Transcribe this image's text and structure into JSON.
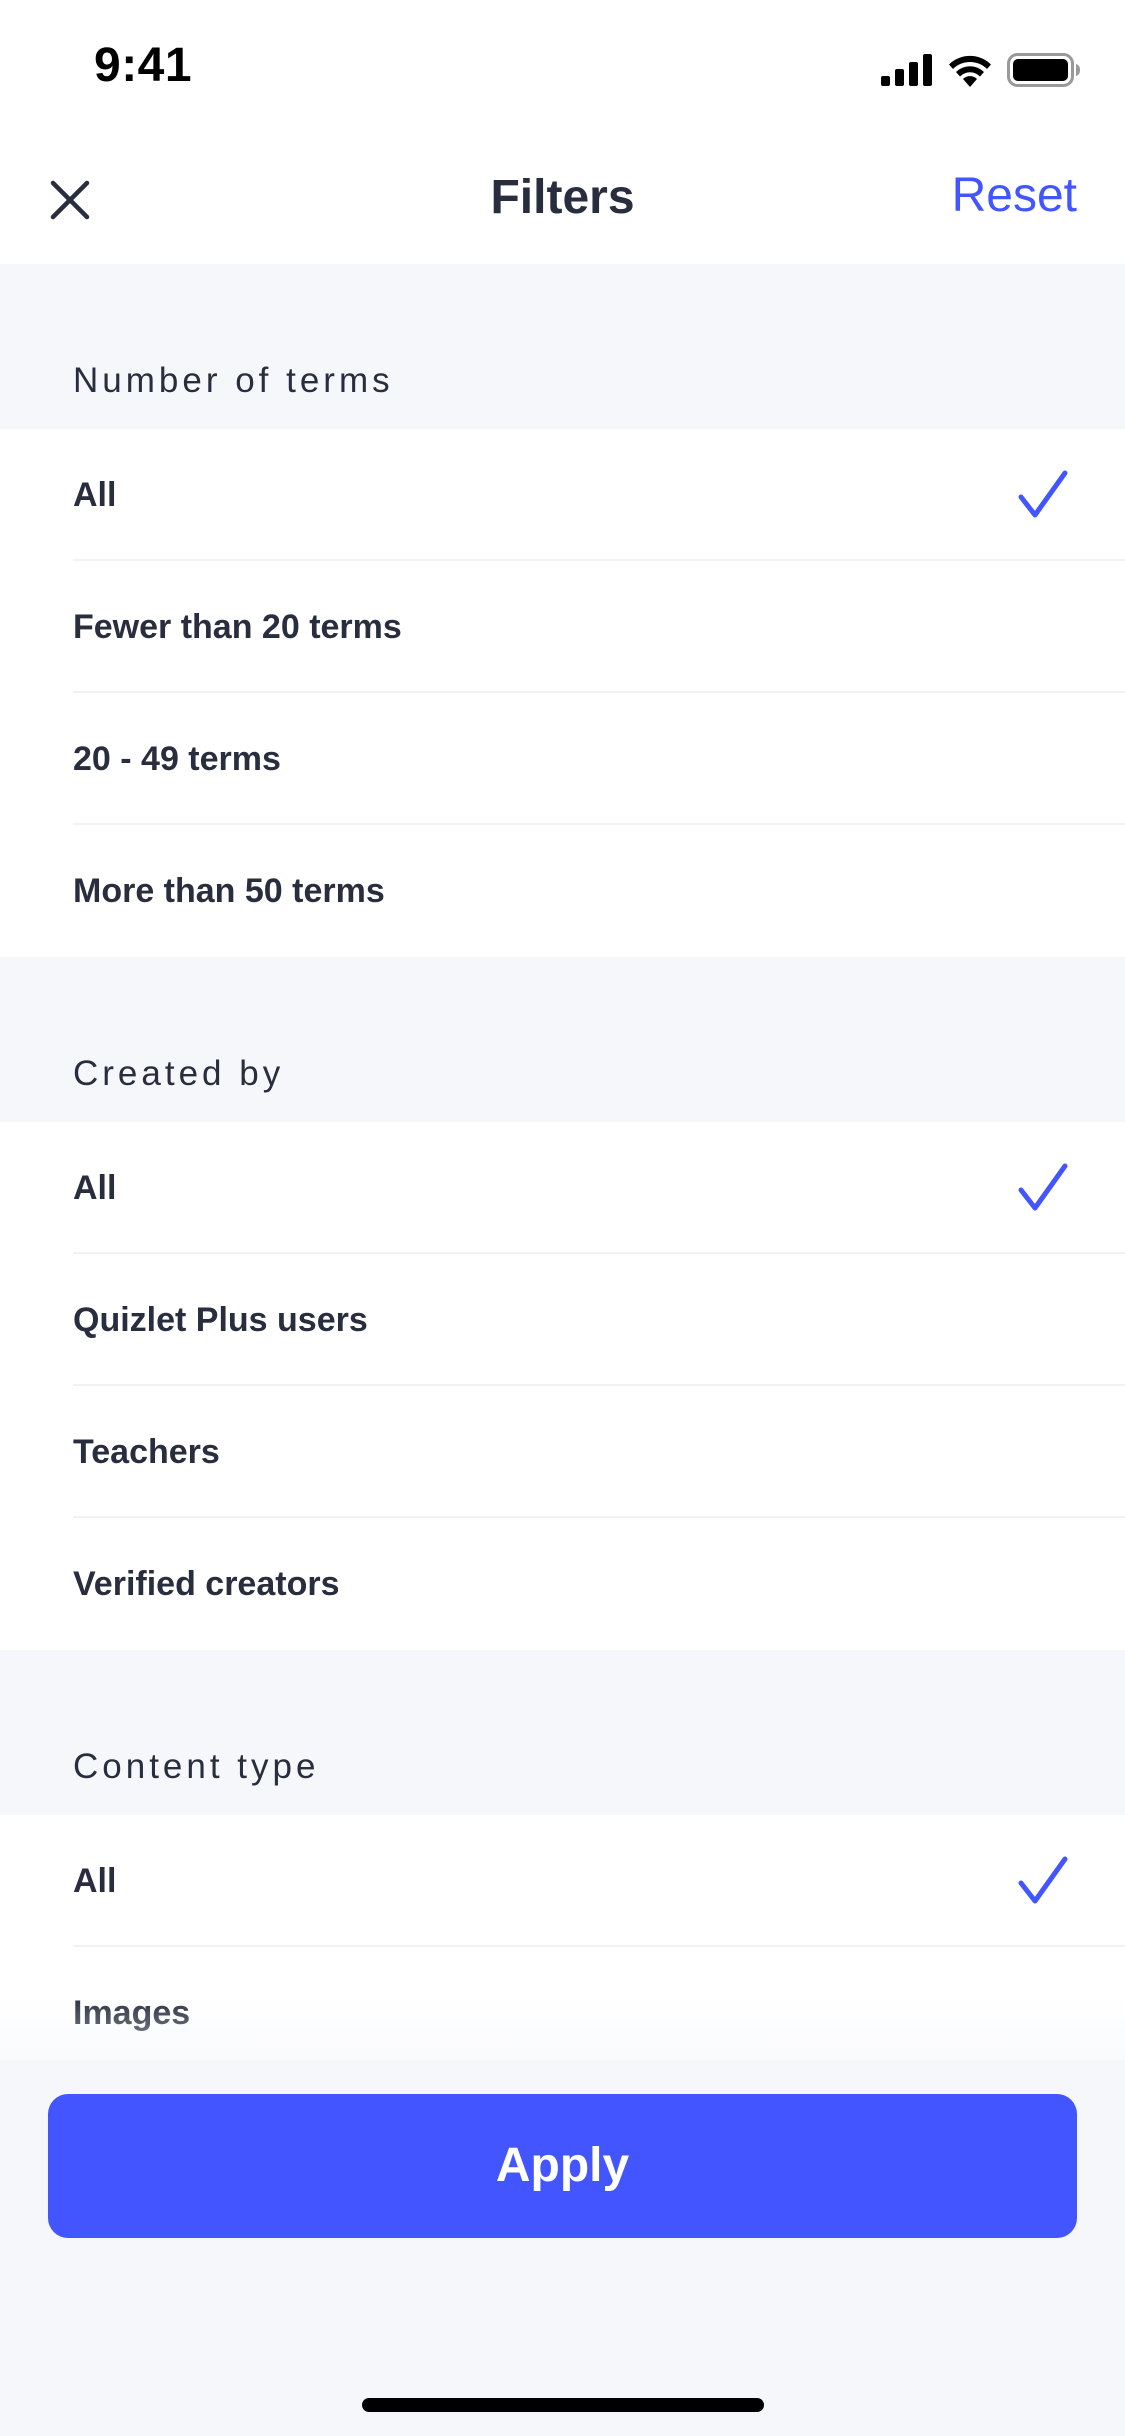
{
  "status_bar": {
    "time": "9:41"
  },
  "nav": {
    "title": "Filters",
    "reset_label": "Reset"
  },
  "sections": [
    {
      "header": "Number of terms",
      "options": [
        {
          "label": "All",
          "selected": true
        },
        {
          "label": "Fewer than 20 terms",
          "selected": false
        },
        {
          "label": "20 - 49 terms",
          "selected": false
        },
        {
          "label": "More than 50 terms",
          "selected": false
        }
      ]
    },
    {
      "header": "Created by",
      "options": [
        {
          "label": "All",
          "selected": true
        },
        {
          "label": "Quizlet Plus users",
          "selected": false
        },
        {
          "label": "Teachers",
          "selected": false
        },
        {
          "label": "Verified creators",
          "selected": false
        }
      ]
    },
    {
      "header": "Content type",
      "options": [
        {
          "label": "All",
          "selected": true
        },
        {
          "label": "Images",
          "selected": false
        }
      ]
    }
  ],
  "apply_label": "Apply",
  "colors": {
    "accent": "#4255ff",
    "text": "#282e3e",
    "background": "#f6f7fb"
  },
  "icons": {
    "close": "close-icon",
    "check": "checkmark-icon",
    "signal": "cellular-signal-icon",
    "wifi": "wifi-icon",
    "battery": "battery-icon"
  }
}
